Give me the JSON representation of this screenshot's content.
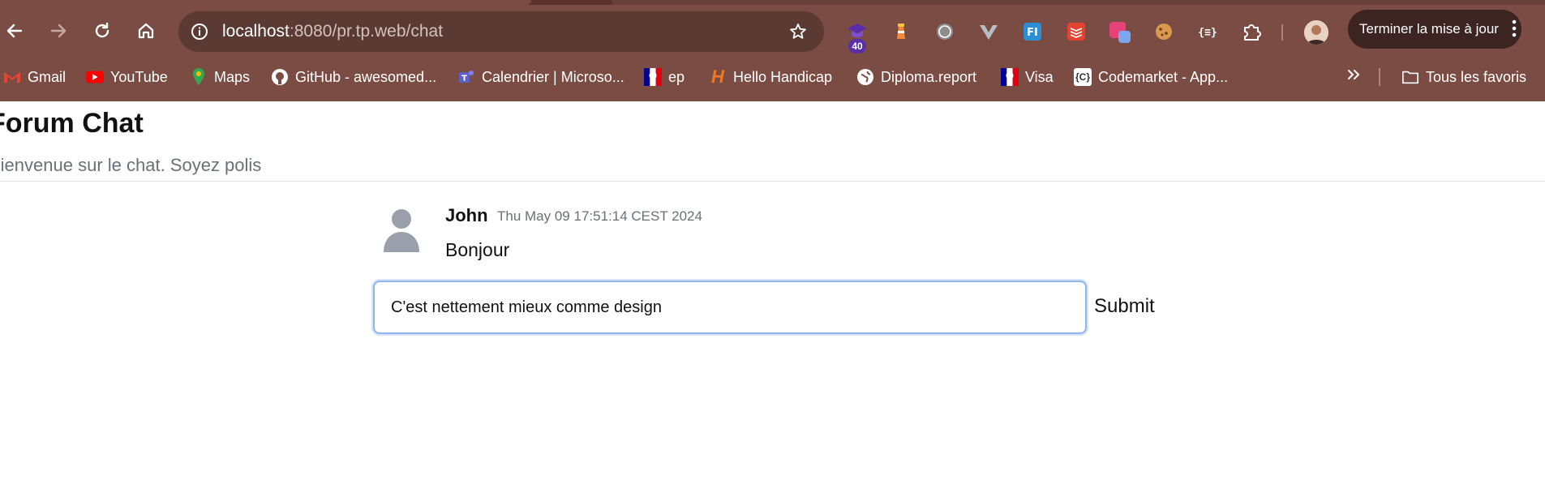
{
  "browser": {
    "address_bar": {
      "host": "localhost",
      "path": ":8080/pr.tp.web/chat"
    },
    "extension_badge_count": "40",
    "update_button_label": "Terminer la mise à jour",
    "bookmarks": [
      {
        "label": "Gmail",
        "icon": "gmail-icon"
      },
      {
        "label": "YouTube",
        "icon": "youtube-icon"
      },
      {
        "label": "Maps",
        "icon": "maps-icon"
      },
      {
        "label": "GitHub - awesomed...",
        "icon": "github-icon"
      },
      {
        "label": "Calendrier | Microso...",
        "icon": "teams-icon"
      },
      {
        "label": "ep",
        "icon": "marianne-icon"
      },
      {
        "label": "Hello Handicap",
        "icon": "hello-handicap-icon"
      },
      {
        "label": "Diploma.report",
        "icon": "globe-icon"
      },
      {
        "label": "Visa",
        "icon": "marianne-icon"
      },
      {
        "label": "Codemarket - App...",
        "icon": "codemarket-icon"
      }
    ],
    "all_bookmarks_label": "Tous les favoris"
  },
  "page": {
    "title": "Forum Chat",
    "subtitle": "Bienvenue sur le chat. Soyez polis"
  },
  "messages": [
    {
      "author": "John",
      "timestamp": "Thu May 09 17:51:14 CEST 2024",
      "text": "Bonjour"
    }
  ],
  "composer": {
    "value": "C'est nettement mieux comme design",
    "submit_label": "Submit"
  },
  "colors": {
    "chrome_frame": "#7a4c44",
    "omnibox": "#5b3a33",
    "focus_ring": "#8fb4f2",
    "muted_text": "#6b6f78"
  }
}
